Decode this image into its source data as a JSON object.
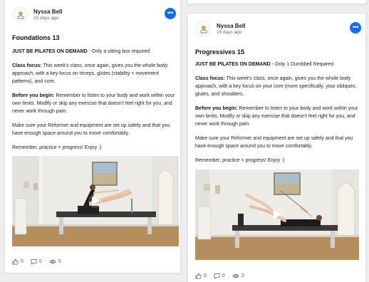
{
  "posts": [
    {
      "author": "Nyssa Bell",
      "date": "15 days ago",
      "title": "Foundations 13",
      "lead_bold": "JUST BE PILATES ON DEMAND",
      "lead_rest": " - Only a sitting box required",
      "focus_label": "Class focus:",
      "focus_text": " This week's class, once again, gives you the whole body approach, with a key focus on triceps, glutes (stability + movement patterns), and core.",
      "begin_label": "Before you begin:",
      "begin_text": " Remember to listen to your body and work within your own limits. Modify or skip any exercise that doesn't feel right for you, and never work through pain.",
      "setup_text": "Make sure your Reformer and equipment are set up safely and that you have enough space around you to move comfortably.",
      "closing_text": "Remember, practice = progress!  Enjoy :)",
      "likes": "0",
      "comments": "0",
      "views": "5"
    },
    {
      "author": "Nyssa Bell",
      "date": "15 days ago",
      "title": "Progressives 15",
      "lead_bold": "JUST BE PILATES ON DEMAND",
      "lead_rest": " - Only 1 Dumbbell Required",
      "focus_label": "Class focus:",
      "focus_text": " This week's class, once again, gives you the whole body approach, with a key focus on your core (more specifically, your obliques, glutes, and shoulders.",
      "begin_label": "Before you begin:",
      "begin_text": " Remember to listen to your body and work within your own limits. Modify or skip any exercise that doesn't feel right for you, and never work through pain.",
      "setup_text": "Make sure your Reformer and equipment are set up safely and that you have enough space around you to move comfortably.",
      "closing_text": "Remember, practice = progress!  Enjoy :)",
      "likes": "0",
      "comments": "0",
      "views": "2"
    }
  ],
  "colors": {
    "accent": "#116dff",
    "page_bg": "#eeeeee",
    "card_bg": "#ffffff"
  },
  "icons": {
    "more": "more-horizontal-icon",
    "like": "thumbs-up-icon",
    "comment": "comment-icon",
    "view": "eye-icon",
    "play": "play-icon"
  },
  "more_glyph": "•••"
}
